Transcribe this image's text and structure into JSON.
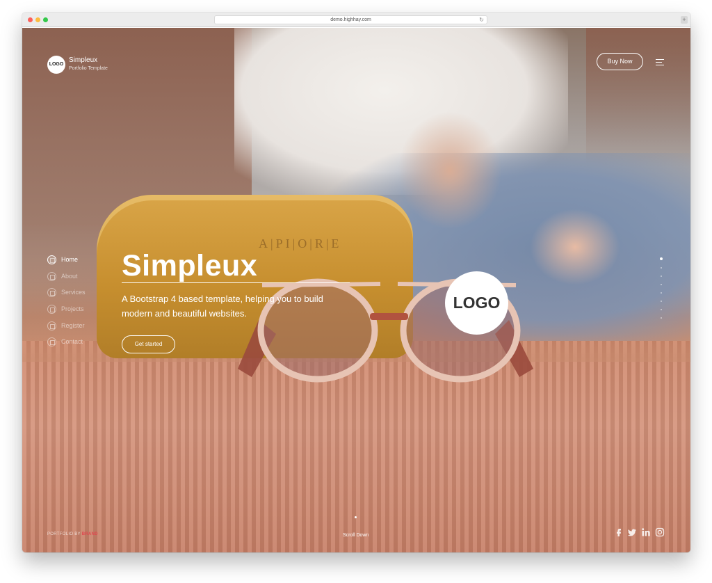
{
  "browser": {
    "url": "demo.highhay.com"
  },
  "header": {
    "logo_text": "LOGO",
    "brand_name": "Simpleux",
    "brand_tagline": "Portfolio Template",
    "buy_label": "Buy Now"
  },
  "nav": {
    "items": [
      {
        "label": "Home",
        "active": true
      },
      {
        "label": "About"
      },
      {
        "label": "Services"
      },
      {
        "label": "Projects"
      },
      {
        "label": "Register"
      },
      {
        "label": "Contact"
      }
    ]
  },
  "hero": {
    "title": "Simpleux",
    "subtitle_line1": "A Bootstrap 4 based template, helping you to build",
    "subtitle_line2": "modern and beautiful websites.",
    "cta_label": "Get started",
    "logo_text": "LOGO",
    "case_text": "A|PI|O|R|E"
  },
  "pager": {
    "count": 8,
    "active_index": 0
  },
  "footer": {
    "brand_prefix": "PORTFOLIO BY ",
    "brand_highlight": "BRAND",
    "scroll_label": "Scroll Down",
    "social": [
      "facebook-icon",
      "twitter-icon",
      "linkedin-icon",
      "instagram-icon"
    ]
  },
  "colors": {
    "accent": "#e0484f",
    "text": "#ffffff"
  }
}
